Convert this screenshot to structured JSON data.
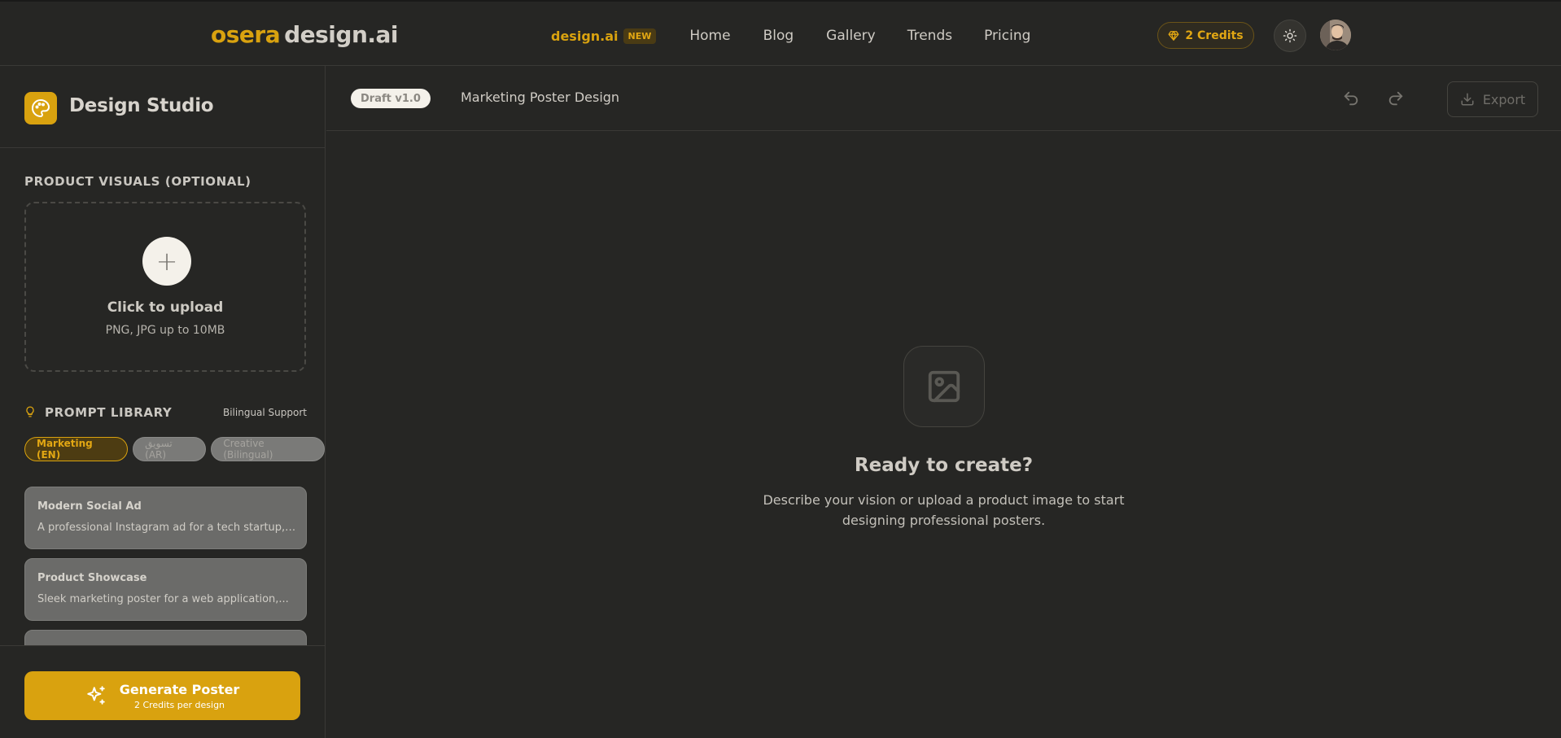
{
  "header": {
    "logo_part1": "osera",
    "logo_part2": "design.ai",
    "nav_brand": "design.ai",
    "nav_badge": "NEW",
    "nav_links": [
      "Home",
      "Blog",
      "Gallery",
      "Trends",
      "Pricing"
    ],
    "credits_label": "2 Credits",
    "theme_icon": "sun-icon",
    "avatar_icon": "user-avatar"
  },
  "sidebar": {
    "title": "Design Studio",
    "title_icon": "palette-icon",
    "product_visuals_label": "PRODUCT VISUALS (OPTIONAL)",
    "upload": {
      "plus": "+",
      "title": "Click to upload",
      "subtitle": "PNG, JPG up to 10MB"
    },
    "prompt_library": {
      "title": "PROMPT LIBRARY",
      "icon": "lightbulb-icon",
      "bilingual_label": "Bilingual Support",
      "chips": [
        "Marketing (EN)",
        "تسويق (AR)",
        "Creative (Bilingual)"
      ],
      "active_chip": "Marketing (EN)",
      "cards": [
        {
          "title": "Modern Social Ad",
          "desc": "A professional Instagram ad for a tech startup, clea..."
        },
        {
          "title": "Product Showcase",
          "desc": "Sleek marketing poster for a web application,..."
        }
      ]
    },
    "generate": {
      "title": "Generate Poster",
      "subtitle": "2 Credits per design",
      "icon": "sparkles-icon"
    }
  },
  "main": {
    "draft_badge": "Draft v1.0",
    "doc_title": "Marketing Poster Design",
    "undo_icon": "undo-icon",
    "redo_icon": "redo-icon",
    "export_label": "Export",
    "empty_state": {
      "icon": "image-icon",
      "title": "Ready to create?",
      "desc_line1": "Describe your vision or upload a product image to start",
      "desc_line2": "designing professional posters."
    }
  },
  "colors": {
    "background": "#262624",
    "accent": "#d9a20f",
    "border": "#3a3936"
  }
}
